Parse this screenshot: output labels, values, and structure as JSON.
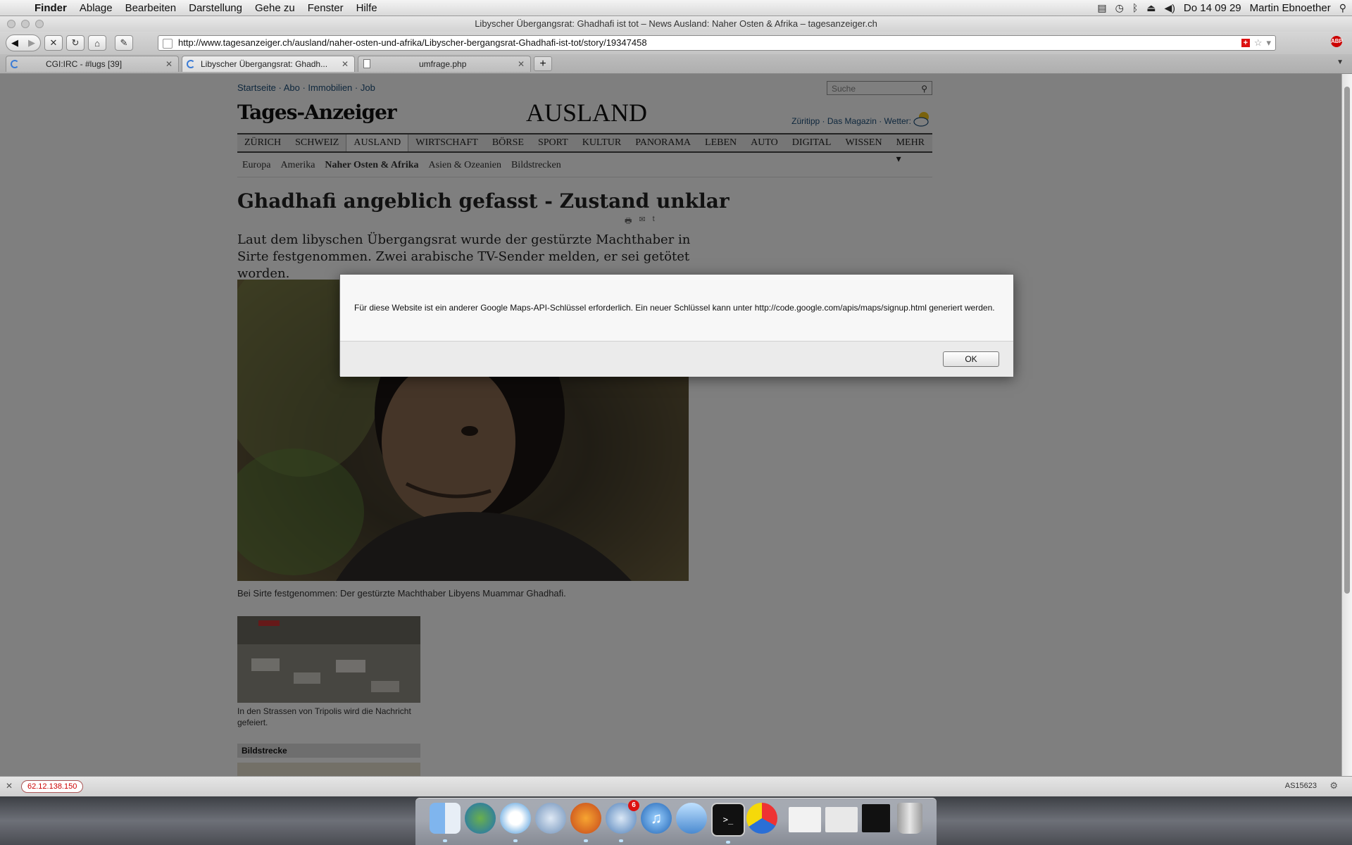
{
  "menubar": {
    "app": "Finder",
    "items": [
      "Ablage",
      "Bearbeiten",
      "Darstellung",
      "Gehe zu",
      "Fenster",
      "Hilfe"
    ],
    "clock": "Do 14 09 29",
    "user": "Martin Ebnoether"
  },
  "window": {
    "title": "Libyscher Übergangsrat: Ghadhafi ist tot – News Ausland: Naher Osten & Afrika – tagesanzeiger.ch"
  },
  "browser": {
    "url": "http://www.tagesanzeiger.ch/ausland/naher-osten-und-afrika/Libyscher-bergangsrat-Ghadhafi-ist-tot/story/19347458",
    "tabs": [
      {
        "label": "CGI:IRC - #lugs [39]",
        "icon": "loading-spinner-icon"
      },
      {
        "label": "Libyscher Übergangsrat: Ghadh...",
        "icon": "loading-spinner-icon"
      },
      {
        "label": "umfrage.php",
        "icon": "document-icon"
      }
    ],
    "newtab": "+",
    "status_ip": "62.12.138.150",
    "status_as": "AS15623"
  },
  "site": {
    "toplinks": "Startseite · Abo · Immobilien · Job",
    "search_placeholder": "Suche",
    "logo": "Tages-Anzeiger",
    "section": "AUSLAND",
    "header_links": "Züritipp · Das Magazin · Wetter:",
    "nav": [
      "ZÜRICH",
      "SCHWEIZ",
      "AUSLAND",
      "WIRTSCHAFT",
      "BÖRSE",
      "SPORT",
      "KULTUR",
      "PANORAMA",
      "LEBEN",
      "AUTO",
      "DIGITAL",
      "WISSEN"
    ],
    "nav_more": "MEHR ▾",
    "subnav": [
      "Europa",
      "Amerika",
      "Naher Osten & Afrika",
      "Asien & Ozeanien",
      "Bildstrecken"
    ]
  },
  "article": {
    "headline": "Ghadhafi angeblich gefasst - Zustand unklar",
    "lead": "Laut dem libyschen Übergangsrat wurde der gestürzte Machthaber in Sirte festgenommen. Zwei arabische TV-Sender melden, er sei getötet worden.",
    "caption": "Bei Sirte festgenommen: Der gestürzte Machthaber Libyens Muammar Ghadhafi.",
    "thumb_caption": "In den Strassen von Tripolis wird die Nachricht gefeiert.",
    "bildstrecke": "Bildstrecke"
  },
  "dialog": {
    "message": "Für diese Website ist ein anderer Google Maps-API-Schlüssel erforderlich. Ein neuer Schlüssel kann unter http://code.google.com/apis/maps/signup.html generiert werden.",
    "ok": "OK"
  },
  "dock": {
    "icons": [
      "finder-icon",
      "globe-icon",
      "safari-icon",
      "compass-icon",
      "firefox-icon",
      "mail-icon",
      "itunes-icon",
      "preview-icon",
      "terminal-icon",
      "color-picker-icon",
      "window-thumbnail-icon",
      "window-thumbnail-icon",
      "window-thumbnail-icon",
      "trash-icon"
    ],
    "mail_badge": "6"
  }
}
